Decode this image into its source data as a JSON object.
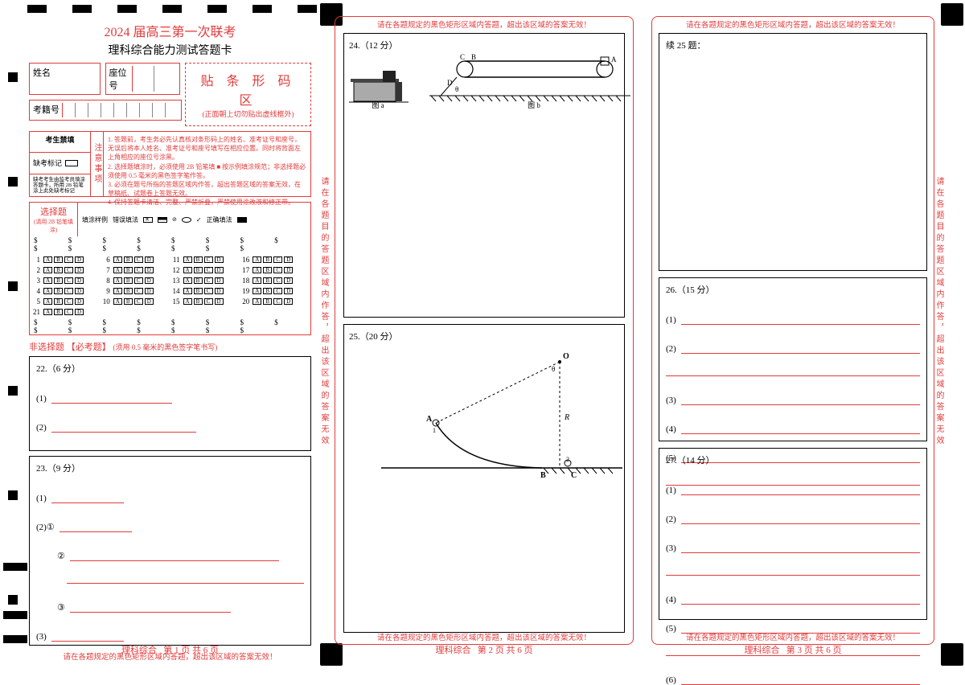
{
  "header": {
    "title": "2024 届高三第一次联考",
    "subtitle": "理科综合能力测试答题卡"
  },
  "idfields": {
    "name_lbl": "姓名",
    "seat_lbl": "座位号",
    "exam_lbl": "考籍号"
  },
  "barcode": {
    "title": "贴 条 形 码 区",
    "note": "(正面朝上切勿贴出虚线框外)"
  },
  "forbid": {
    "title": "考生禁填",
    "absent_lbl": "缺考标记",
    "absent_note": "缺考考生由监考员填涂答题卡，所用 2B 铅笔涂上此处缺考标记"
  },
  "instr_title": "注意事项",
  "instructions": [
    "1. 答题前，考生务必先认真核对条形码上的姓名、准考证号和座号，无误后将本人姓名、准考证号和座号填写在相应位置。同时将背面左上角相应的座位号涂黑。",
    "2. 选择题填涂时，必须使用 2B 铅笔填 ■ 按示例填涂规范；非选择题必须使用 0.5 毫米的黑色签字笔作答。",
    "3. 必须在题号所指的答题区域内作答，超出答题区域的答案无效，在草稿纸、试题卷上答题无效。",
    "4. 保持答题卡清洁、完整、严禁折叠，严禁使用涂改液和修正带。"
  ],
  "mc": {
    "label": "选择题",
    "sub": "(请用 2B 铅笔填涂)",
    "demo_lbl": "填涂样例",
    "demo_wrong": "错误填法",
    "demo_right": "正确填法",
    "letters": [
      "A",
      "B",
      "C",
      "D"
    ],
    "numbers": [
      1,
      2,
      3,
      4,
      5,
      6,
      7,
      8,
      9,
      10,
      11,
      12,
      13,
      14,
      15,
      16,
      17,
      18,
      19,
      20,
      21
    ]
  },
  "frq": {
    "title": "非选择题 【必考题】",
    "note": "(须用 0.5 毫米的黑色签字笔书写)"
  },
  "col1_q": {
    "q22": "22.（6 分）",
    "q22_items": [
      "(1)",
      "(2)"
    ],
    "q23": "23.（9 分）",
    "q23_items": [
      "(1)",
      "(2)①",
      "②",
      "③",
      "(3)"
    ]
  },
  "col2_q": {
    "q24": "24.（12 分）",
    "fig_a": "图 a",
    "fig_b": "图 b",
    "q25": "25.（20 分）",
    "labels": {
      "O": "O",
      "A": "A",
      "B": "B",
      "C": "C",
      "R": "R",
      "theta": "θ",
      "one": "1",
      "two": "2",
      "D": "D"
    }
  },
  "col3_q": {
    "q25c": "续 25 题：",
    "q26": "26.（15 分）",
    "q26_items": [
      "(1)",
      "(2)",
      "(3)",
      "(4)",
      "(5)"
    ],
    "q27": "27.（14 分）",
    "q27_items": [
      "(1)",
      "(2)",
      "(3)",
      "(4)",
      "(5)",
      "(6)"
    ]
  },
  "warning": "请在各题规定的黑色矩形区域内答题，超出该区域的答案无效！",
  "side_text": "请在各题目的答题区域内作答，超出该区域的答案无效",
  "footer": {
    "subject": "理科综合",
    "p1": "第 1 页  共 6 页",
    "p2": "第 2 页  共 6 页",
    "p3": "第 3 页  共 6 页"
  }
}
